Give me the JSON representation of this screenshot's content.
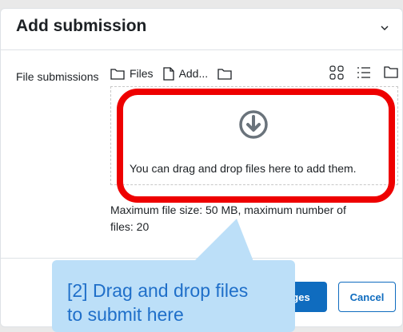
{
  "form": {
    "title": "Add submission",
    "collapse_icon": "chevron-down-icon",
    "field_label": "File submissions"
  },
  "filepicker": {
    "files_label": "Files",
    "add_label": "Add...",
    "drop_text": "You can drag and drop files here to add them.",
    "limits_line1": "Maximum file size: 50 MB, maximum number of",
    "limits_line2": "files: 20"
  },
  "buttons": {
    "save_label": "ges",
    "cancel_label": "Cancel"
  },
  "callout": {
    "line1": "[2] Drag and drop files",
    "line2": "to submit here"
  },
  "colors": {
    "primary": "#0f6cbf",
    "highlight": "#ee0000",
    "callout_bg": "#bcdff8",
    "callout_text": "#1f6fc9"
  }
}
